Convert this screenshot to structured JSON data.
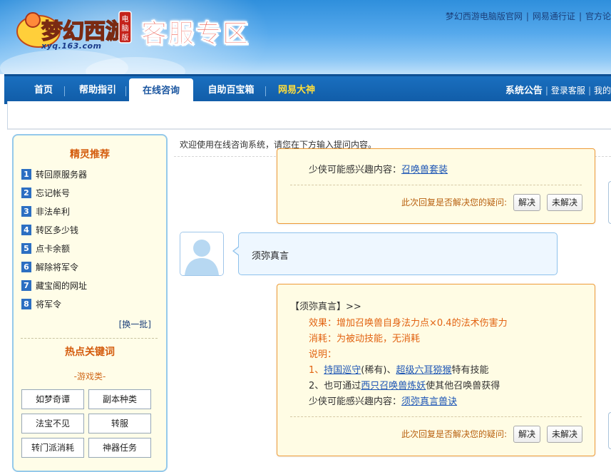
{
  "header": {
    "logo_text": "梦幻西游",
    "logo_badge": "电脑版",
    "logo_url": "xyq.163.com",
    "title": "客服专区",
    "top_links": [
      "梦幻西游电脑版官网",
      "网易通行证",
      "官方论"
    ]
  },
  "nav": {
    "items": [
      "首页",
      "帮助指引",
      "在线咨询",
      "自助百宝箱",
      "网易大神"
    ],
    "active_index": 2,
    "right_bold": "系统公告",
    "right_links": [
      "登录客服",
      "我的"
    ]
  },
  "sidebar": {
    "title": "精灵推荐",
    "items": [
      {
        "num": "1",
        "label": "转回原服务器"
      },
      {
        "num": "2",
        "label": "忘记帐号"
      },
      {
        "num": "3",
        "label": "非法牟利"
      },
      {
        "num": "4",
        "label": "转区多少钱"
      },
      {
        "num": "5",
        "label": "点卡余额"
      },
      {
        "num": "6",
        "label": "解除将军令"
      },
      {
        "num": "7",
        "label": "藏宝阁的网址"
      },
      {
        "num": "8",
        "label": "将军令"
      }
    ],
    "change_batch": "[换一批]",
    "hot_title": "热点关键词",
    "category": "-游戏类-",
    "keywords": [
      "如梦奇谭",
      "副本种类",
      "法宝不见",
      "转服",
      "转门派消耗",
      "神器任务"
    ]
  },
  "main": {
    "welcome": "欢迎使用在线咨询系统，请您在下方输入提问内容。",
    "reply1": {
      "interest_prefix": "少侠可能感兴趣内容：",
      "interest_link": "召唤兽套装",
      "solve_question": "此次回复是否解决您的疑问:",
      "solve_btn": "解决",
      "unsolve_btn": "未解决"
    },
    "user_message": "须弥真言",
    "reply2": {
      "heading": "【须弥真言】>>",
      "effect": "效果：增加召唤兽自身法力点×0.4的法术伤害力",
      "cost": "消耗：为被动技能，无消耗",
      "explain": "说明：",
      "item1_prefix": "1、",
      "item1_link1": "持国巡守",
      "item1_mid": "(稀有)、",
      "item1_link2": "超级六耳猕猴",
      "item1_suffix": "特有技能",
      "item2_prefix": "2、也可通过",
      "item2_link": "西只召唤兽炼妖",
      "item2_suffix": "使其他召唤兽获得",
      "interest_prefix": "少侠可能感兴趣内容：",
      "interest_link": "须弥真言兽诀",
      "solve_question": "此次回复是否解决您的疑问:",
      "solve_btn": "解决",
      "unsolve_btn": "未解决"
    }
  },
  "colors": {
    "nav_blue": "#105ba6",
    "accent_orange": "#e26312",
    "link_blue": "#1c55b5",
    "sidebar_bg": "#fffde8"
  }
}
